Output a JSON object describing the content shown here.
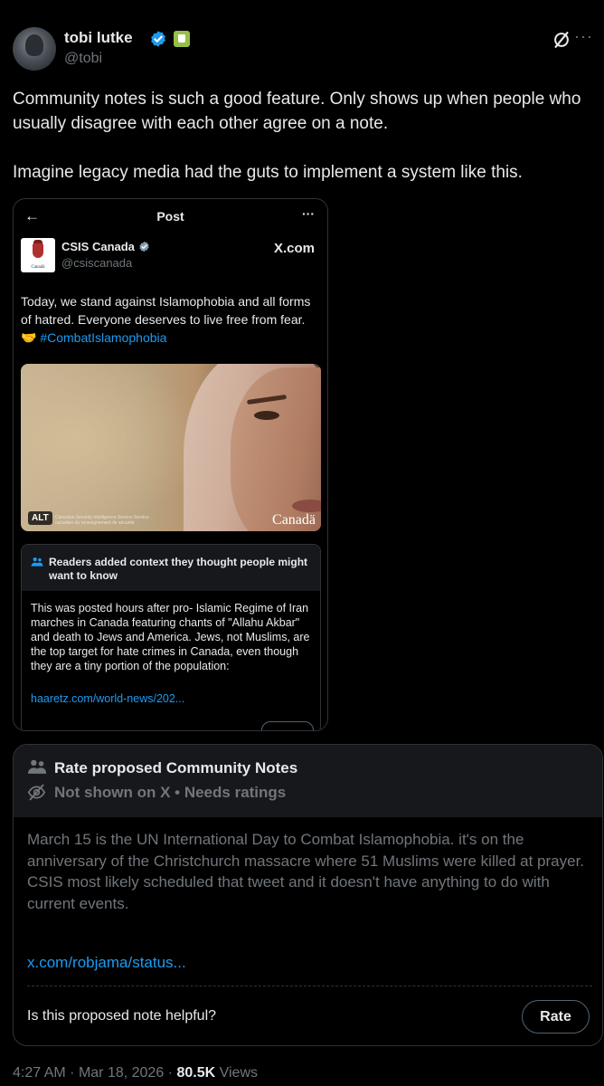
{
  "author": {
    "name": "tobi lutke",
    "handle": "@tobi"
  },
  "tweet": {
    "text": "Community notes is such a good feature. Only shows up when people who usually disagree with each other agree on a note.\n\nImagine legacy media had the guts to implement a system like this."
  },
  "embed": {
    "header_title": "Post",
    "account_name": "CSIS Canada",
    "account_handle": "@csiscanada",
    "site": "X.com",
    "logo_caption": "Canadä",
    "text": "Today, we stand against Islamophobia and all forms of hatred. Everyone deserves to live free from fear. 🤝 ",
    "hashtag": "#CombatIslamophobia",
    "image": {
      "alt_badge": "ALT",
      "small_text": "Canadian Security Intelligence Service  Service canadien du renseignement de sécurité",
      "wordmark": "Canadä"
    },
    "note": {
      "title": "Readers added context they thought people might want to know",
      "body": "This was posted hours after pro- Islamic Regime of Iran marches in Canada featuring chants of \"Allahu Akbar\" and death to Jews and America. Jews, not Muslims, are the top target for hate crimes in Canada, even though they are a tiny portion of the population:",
      "link": "haaretz.com/world-news/202..."
    }
  },
  "proposed_note": {
    "title": "Rate proposed Community Notes",
    "status": "Not shown on X • Needs ratings",
    "body": "March 15 is the UN International Day to Combat Islamophobia. it's on the anniversary of the Christchurch massacre where 51 Muslims were killed at prayer. CSIS most likely scheduled that tweet and it doesn't have anything to do with current events.",
    "link": "x.com/robjama/status...",
    "question": "Is this proposed note helpful?",
    "rate_label": "Rate"
  },
  "meta": {
    "time": "4:27 AM",
    "date": "Mar 18, 2026",
    "views_count": "80.5K",
    "views_label": "Views"
  },
  "colors": {
    "background": "#000000",
    "text": "#e7e9ea",
    "secondary": "#71767b",
    "link": "#1d9bf0",
    "verified": "#1d9bf0",
    "shopify": "#95bf47"
  },
  "icons": [
    "avatar",
    "verified-badge-icon",
    "shopify-badge-icon",
    "grok-icon",
    "more-icon",
    "back-arrow-icon",
    "people-icon",
    "eye-off-icon"
  ]
}
